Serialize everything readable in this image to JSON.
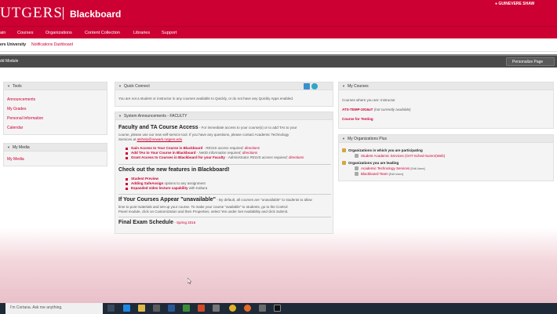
{
  "header": {
    "brand": "UTGERS",
    "app": "Blackboard",
    "user": "GUINEVERE SHAW"
  },
  "nav": [
    "ain",
    "Courses",
    "Organizations",
    "Content Collection",
    "Libraries",
    "Support"
  ],
  "subnav": [
    "ers University",
    "Notifications Dashboard"
  ],
  "modulebar": {
    "add_module": "dd Module",
    "personalize": "Personalize Page"
  },
  "tools": {
    "title": "Tools",
    "items": [
      "Announcements",
      "My Grades",
      "Personal Information",
      "Calendar"
    ]
  },
  "media": {
    "title": "My Media",
    "items": [
      "My Media"
    ]
  },
  "quick": {
    "title": "Quick Connect",
    "text": "You are not a student or instructor in any courses available to Quickly, or do not have any Quickly Apps enabled."
  },
  "announce": {
    "title": "System Announcements - FACULTY",
    "s1_head": "Faculty and TA Course Access",
    "s1_lead": " - For immediate access to your course(s) or to add TAs to your",
    "s1_l2": "course, please use our new self-service tool.   If you have any questions, please contact Academic Technology",
    "s1_l3": "Services at",
    "s1_email": "atshelp@newark.rutgers.edu",
    "s1_items": [
      {
        "link": "Gain Access to Your Course in Blackboard",
        "note": " - REGIS access required;",
        "dir": "directions"
      },
      {
        "link": "Add TAs to Your Course in Blackboard",
        "note": " - NetID information required;",
        "dir": "directions"
      },
      {
        "link": "Grant Access to Courses in Blackboard for your Faculty",
        "note": " - Administrator REGIS access required;",
        "dir": "directions"
      }
    ],
    "s2_head": "Check out the new features in Blackboard!",
    "s2_items": [
      {
        "link": "Student Preview",
        "note": ""
      },
      {
        "link": "Adding SafeAssign",
        "note": " options to any assignment"
      },
      {
        "link": "Expanded video lecture capability",
        "note": " with Kaltura"
      }
    ],
    "s3_head": "If Your Courses Appear \"unavailable\"",
    "s3_l1": " - By default, all courses are \"unavailable\" to students to allow",
    "s3_l2": "time to post materials and set-up your course. To make your course \"available\" to students, go to the Control",
    "s3_l3": "Panel module, click on Customization and then Properties, select Yes under Set Availability and click Submit.",
    "s4_head": "Final Exam Schedule",
    "s4_note": " - Spring 2016"
  },
  "courses": {
    "title": "My Courses",
    "sub": "Courses where you are: Instructor",
    "c1": "ATS-TEMP-2016aT",
    "c1_note": " (not currently available)",
    "c2": "Course for Testing"
  },
  "orgs": {
    "title": "My Organizations Plus",
    "g1": "Organizations in which you are participating",
    "g1_items": [
      "Student Academic Services (OAT-Sched-Summ(Web)"
    ],
    "g2": "Organizations you are leading",
    "g2_items": [
      {
        "name": "Academic Technology Services",
        "note": "[Edit Users]"
      },
      {
        "name": "Blackboard Team",
        "note": "[Edit Users]"
      }
    ]
  },
  "taskbar": {
    "search": "I'm Cortana. Ask me anything."
  },
  "colors": {
    "brand": "#cc0033"
  }
}
